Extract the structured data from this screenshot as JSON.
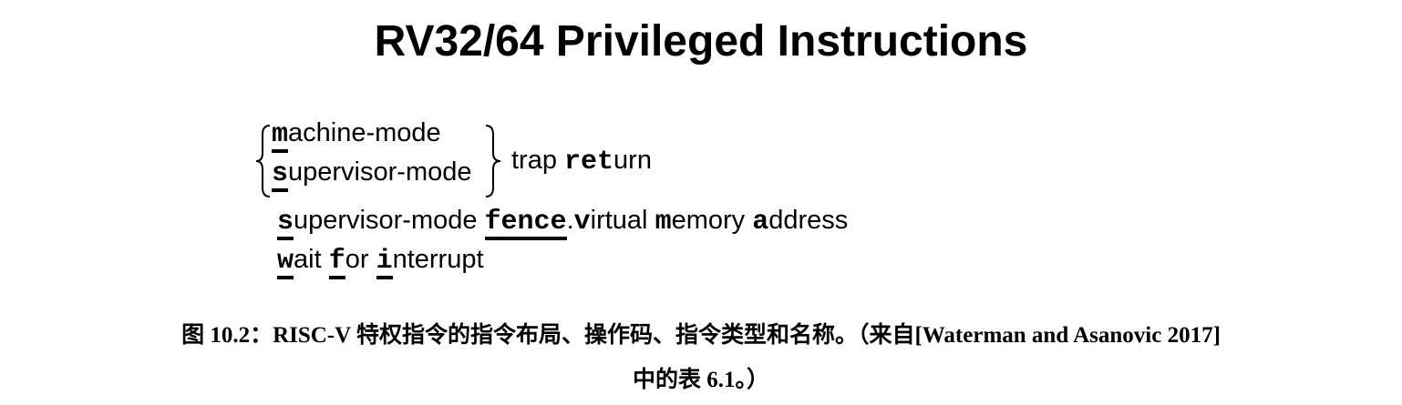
{
  "figure": {
    "title": "RV32/64 Privileged Instructions",
    "trap_return": {
      "line1": {
        "key": "m",
        "rest": "achine-mode"
      },
      "line2": {
        "key": "s",
        "rest": "upervisor-mode"
      },
      "text_trap": "trap ",
      "key_ret": "ret",
      "text_urn": "urn"
    },
    "sfence_vma": {
      "key_s": "s",
      "text_upervisor": "upervisor-mode ",
      "key_fence": "fence",
      "dot": ".",
      "key_v": "v",
      "text_irtual": "irtual ",
      "key_m": "m",
      "text_emory": "emory ",
      "key_a": "a",
      "text_ddress": "ddress"
    },
    "wfi": {
      "key_w": "w",
      "text_ait": "ait ",
      "key_f": "f",
      "text_or": "or ",
      "key_i": "i",
      "text_nterrupt": "nterrupt"
    }
  },
  "caption": {
    "line1": "图 10.2：RISC-V 特权指令的指令布局、操作码、指令类型和名称。（来自[Waterman and Asanovic 2017]",
    "line2": "中的表 6.1。）"
  }
}
